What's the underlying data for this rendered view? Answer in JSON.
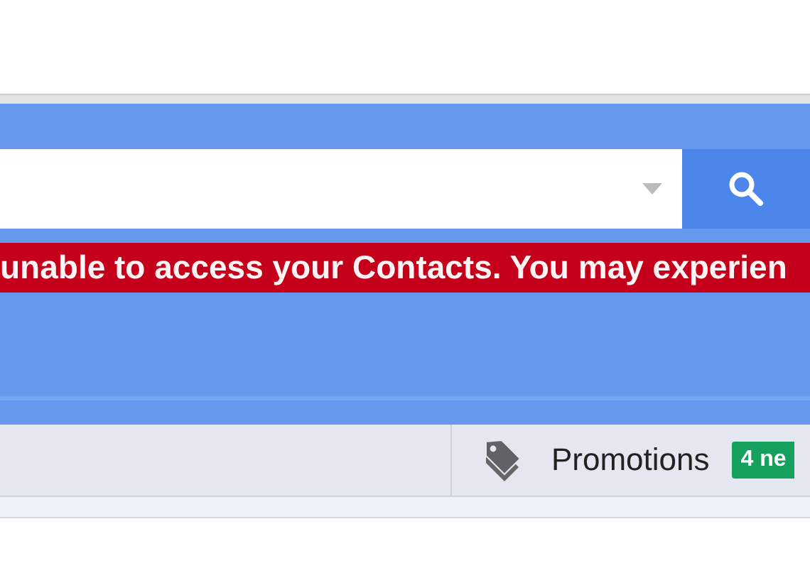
{
  "alert": {
    "text": "unable to access your Contacts. You may experien"
  },
  "tabs": [
    {
      "kind": "blank",
      "selected": false
    },
    {
      "kind": "promotions",
      "label": "Promotions",
      "badge": "4 ne",
      "selected": false
    }
  ]
}
